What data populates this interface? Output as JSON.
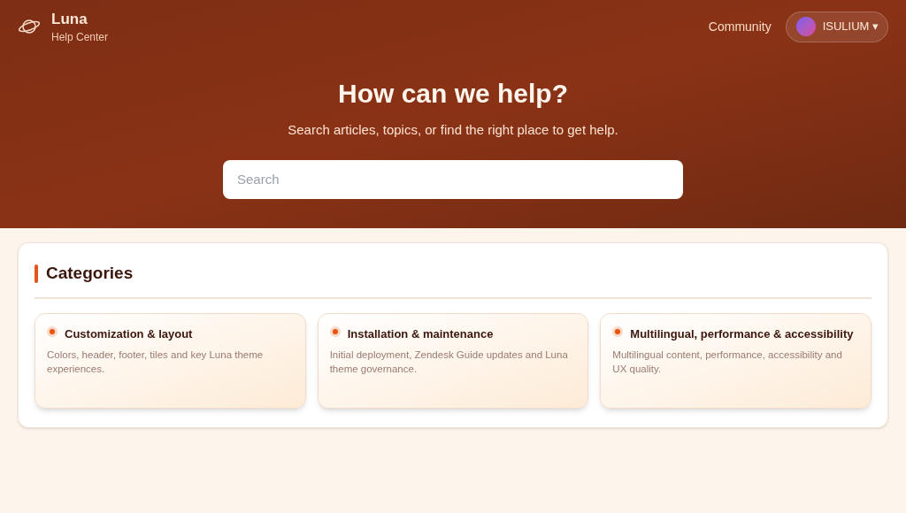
{
  "brand": {
    "name": "Luna",
    "subtitle": "Help Center"
  },
  "nav": {
    "link": "Community",
    "user": "ISULIUM ▾"
  },
  "hero": {
    "title": "How can we help?",
    "subtitle": "Search articles, topics, or find the right place to get help.",
    "search": {
      "placeholder": "Search"
    }
  },
  "categories": {
    "title": "Categories",
    "items": [
      {
        "title": "Customization & layout",
        "description": "Colors, header, footer, tiles and key Luna theme experiences."
      },
      {
        "title": "Installation & maintenance",
        "description": "Initial deployment, Zendesk Guide updates and Luna theme governance."
      },
      {
        "title": "Multilingual, performance & accessibility",
        "description": "Multilingual content, performance, accessibility and UX quality."
      }
    ]
  }
}
